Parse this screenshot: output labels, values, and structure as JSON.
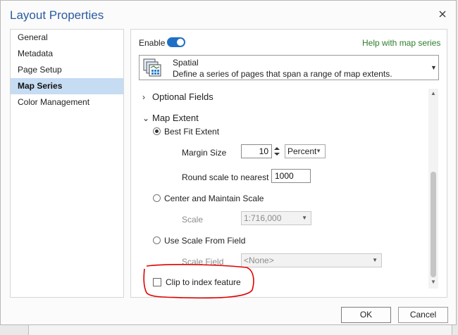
{
  "window": {
    "title": "Layout Properties",
    "close_icon": "close-icon"
  },
  "nav": {
    "items": [
      {
        "label": "General"
      },
      {
        "label": "Metadata"
      },
      {
        "label": "Page Setup"
      },
      {
        "label": "Map Series"
      },
      {
        "label": "Color Management"
      }
    ],
    "active": "Map Series"
  },
  "panel": {
    "enable_label": "Enable",
    "enable_on": true,
    "help_link": "Help with map series",
    "series_type": {
      "name": "Spatial",
      "description": "Define a series of pages that span a range of map extents.",
      "icon": "spatial-map-series-icon"
    },
    "optional_fields": {
      "label": "Optional Fields",
      "expanded": false
    },
    "map_extent": {
      "label": "Map Extent",
      "expanded": true,
      "best_fit": {
        "label": "Best Fit Extent",
        "selected": true,
        "margin_size_label": "Margin Size",
        "margin_size_value": "10",
        "margin_unit": "Percent",
        "round_scale_label": "Round scale to nearest",
        "round_scale_value": "1000"
      },
      "center_maintain": {
        "label": "Center and Maintain Scale",
        "selected": false,
        "scale_label": "Scale",
        "scale_value": "1:716,000"
      },
      "scale_from_field": {
        "label": "Use Scale From Field",
        "selected": false,
        "scale_field_label": "Scale Field",
        "scale_field_value": "<None>"
      }
    },
    "clip_to_index": {
      "label": "Clip to index feature",
      "checked": false
    }
  },
  "footer": {
    "ok_label": "OK",
    "cancel_label": "Cancel"
  },
  "colors": {
    "accent": "#1f6fc6",
    "title": "#2a5ba0",
    "link": "#2c7d2c",
    "nav_selected": "#c6dcf2",
    "annotation": "#e00000"
  }
}
